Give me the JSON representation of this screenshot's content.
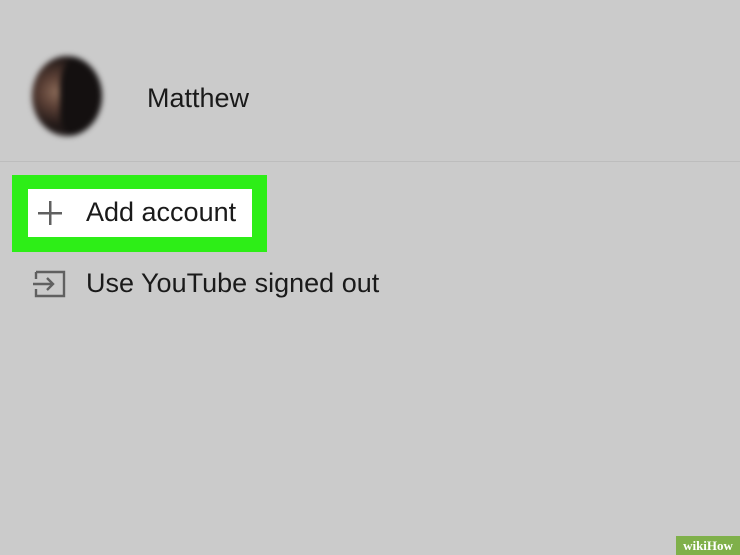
{
  "account": {
    "name": "Matthew"
  },
  "menu": {
    "add_account_label": "Add account",
    "signed_out_label": "Use YouTube signed out"
  },
  "icons": {
    "add": "plus-icon",
    "signed_out": "exit-icon"
  },
  "colors": {
    "background": "#cbcbcb",
    "highlight": "#2dee17",
    "highlight_fill": "#ffffff",
    "text": "#1a1a1a",
    "icon": "#606060"
  },
  "watermark": {
    "text": "wikiHow"
  }
}
